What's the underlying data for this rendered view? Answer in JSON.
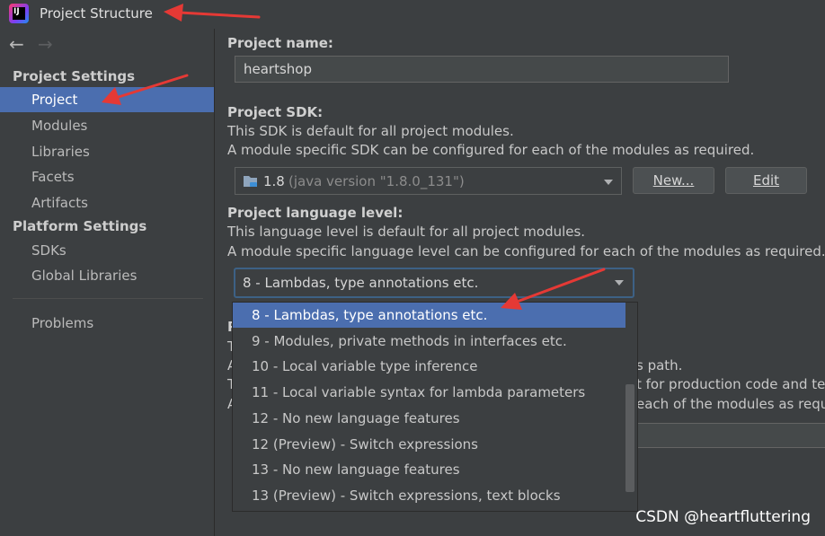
{
  "window": {
    "title": "Project Structure"
  },
  "sidebar": {
    "project_settings_header": "Project Settings",
    "platform_settings_header": "Platform Settings",
    "items": [
      {
        "label": "Project",
        "selected": true
      },
      {
        "label": "Modules"
      },
      {
        "label": "Libraries"
      },
      {
        "label": "Facets"
      },
      {
        "label": "Artifacts"
      },
      {
        "label": "SDKs"
      },
      {
        "label": "Global Libraries"
      },
      {
        "label": "Problems"
      }
    ]
  },
  "main": {
    "project_name_label": "Project name:",
    "project_name_value": "heartshop",
    "sdk_label": "Project SDK:",
    "sdk_desc_1": "This SDK is default for all project modules.",
    "sdk_desc_2": "A module specific SDK can be configured for each of the modules as required.",
    "sdk_selected": "1.8",
    "sdk_selected_detail": "(java version \"1.8.0_131\")",
    "new_button": "New...",
    "edit_button": "Edit",
    "language_level_label": "Project language level:",
    "language_desc_1": "This language level is default for all project modules.",
    "language_desc_2": "A module specific language level can be configured for each of the modules as required.",
    "language_selected": "8 - Lambdas, type annotations etc.",
    "hidden_fragments": {
      "label_initial": "P",
      "line_1_start": "T",
      "line_2_start": "A",
      "line_2_end": "s path.",
      "line_3_start": "T",
      "line_3_end": "t for production code and tes",
      "line_4_start": "A",
      "line_4_end": "each of the modules as requi"
    },
    "language_options": [
      "8 - Lambdas, type annotations etc.",
      "9 - Modules, private methods in interfaces etc.",
      "10 - Local variable type inference",
      "11 - Local variable syntax for lambda parameters",
      "12 - No new language features",
      "12 (Preview) - Switch expressions",
      "13 - No new language features",
      "13 (Preview) - Switch expressions, text blocks"
    ]
  },
  "watermark": "CSDN @heartfluttering",
  "colors": {
    "selection": "#4b6eaf",
    "background": "#3c3f41",
    "annotation_arrow": "#e53935"
  }
}
